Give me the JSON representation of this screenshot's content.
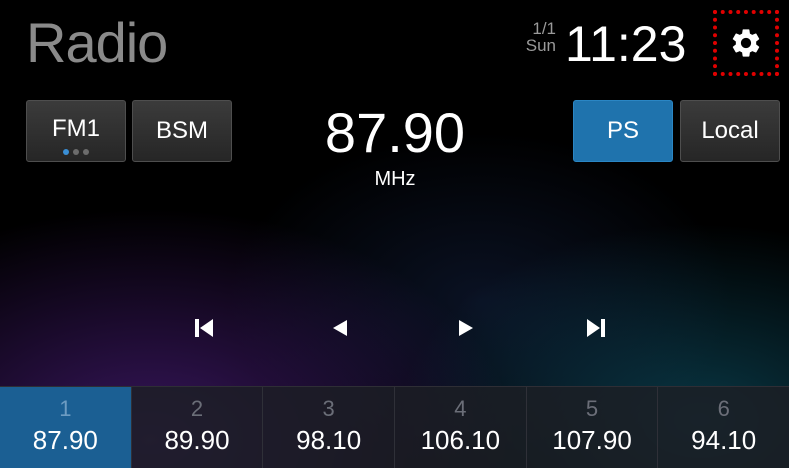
{
  "header": {
    "title": "Radio",
    "date": "1/1",
    "weekday": "Sun",
    "time": "11:23",
    "settings_icon": "gear-icon"
  },
  "controls": {
    "band_label": "FM1",
    "band_pages": 3,
    "band_active_page": 1,
    "bsm_label": "BSM",
    "ps_label": "PS",
    "local_label": "Local"
  },
  "tuner": {
    "frequency": "87.90",
    "unit": "MHz"
  },
  "transport": {
    "prev_station_icon": "skip-previous-icon",
    "seek_back_icon": "seek-back-icon",
    "seek_forward_icon": "seek-forward-icon",
    "next_station_icon": "skip-next-icon"
  },
  "presets": [
    {
      "number": "1",
      "frequency": "87.90",
      "active": true
    },
    {
      "number": "2",
      "frequency": "89.90",
      "active": false
    },
    {
      "number": "3",
      "frequency": "98.10",
      "active": false
    },
    {
      "number": "4",
      "frequency": "106.10",
      "active": false
    },
    {
      "number": "5",
      "frequency": "107.90",
      "active": false
    },
    {
      "number": "6",
      "frequency": "94.10",
      "active": false
    }
  ],
  "colors": {
    "accent": "#1f73ad",
    "highlight_frame": "#e00000",
    "title_gray": "#8a8a8a"
  }
}
